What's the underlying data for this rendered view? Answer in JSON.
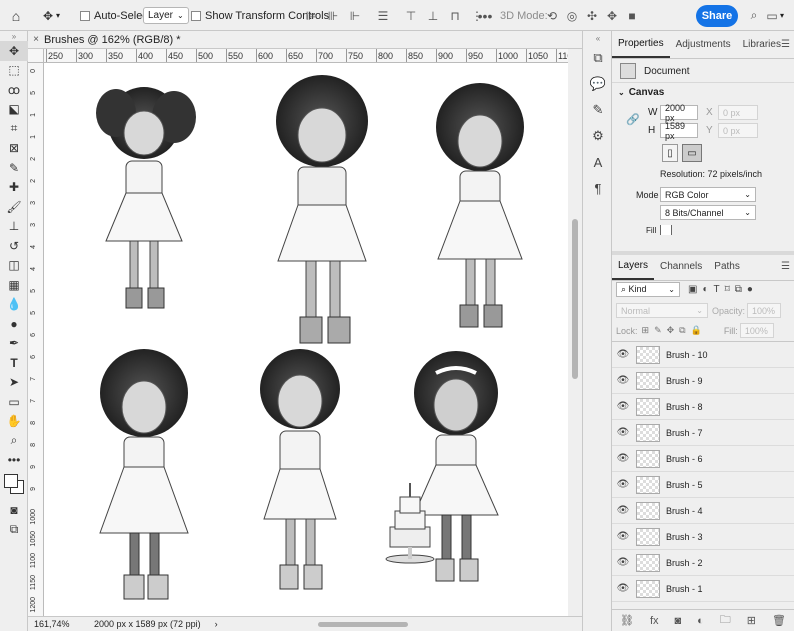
{
  "options_bar": {
    "auto_select_label": "Auto-Select:",
    "layer_select": "Layer",
    "show_transform_label": "Show Transform Controls",
    "mode_3d_label": "3D Mode:",
    "share_label": "Share"
  },
  "document": {
    "tab_title": "Brushes @ 162% (RGB/8) *",
    "ruler_h": [
      "250",
      "300",
      "350",
      "400",
      "450",
      "500",
      "550",
      "600",
      "650",
      "700",
      "750",
      "800",
      "850",
      "900",
      "950",
      "1000",
      "1050",
      "110"
    ],
    "ruler_v": [
      "0",
      "5",
      "1",
      "1",
      "2",
      "2",
      "3",
      "3",
      "4",
      "4",
      "5",
      "5",
      "6",
      "6",
      "7",
      "7",
      "8",
      "8",
      "9",
      "9",
      "1000",
      "1050",
      "1100",
      "1150",
      "1200"
    ],
    "zoom": "161,74%",
    "doc_info": "2000 px x 1589 px (72 ppi)"
  },
  "properties": {
    "tabs": [
      "Properties",
      "Adjustments",
      "Libraries"
    ],
    "document_label": "Document",
    "canvas_label": "Canvas",
    "w_label": "W",
    "w_value": "2000 px",
    "h_label": "H",
    "h_value": "1589 px",
    "x_label": "X",
    "x_placeholder": "0 px",
    "y_label": "Y",
    "y_placeholder": "0 px",
    "resolution": "Resolution: 72 pixels/inch",
    "mode_label": "Mode",
    "mode_value": "RGB Color",
    "bits_value": "8 Bits/Channel",
    "fill_label": "Fill"
  },
  "layers": {
    "tabs": [
      "Layers",
      "Channels",
      "Paths"
    ],
    "kind_label": "Kind",
    "blend_mode": "Normal",
    "opacity_label": "Opacity:",
    "opacity_value": "100%",
    "lock_label": "Lock:",
    "fill_label": "Fill:",
    "fill_value": "100%",
    "items": [
      "Brush - 10",
      "Brush - 9",
      "Brush - 8",
      "Brush - 7",
      "Brush - 6",
      "Brush - 5",
      "Brush - 4",
      "Brush - 3",
      "Brush - 2",
      "Brush - 1"
    ]
  },
  "colors": {
    "accent": "#1473e6",
    "panel_bg": "#efefef",
    "canvas_bg": "#ffffff"
  }
}
